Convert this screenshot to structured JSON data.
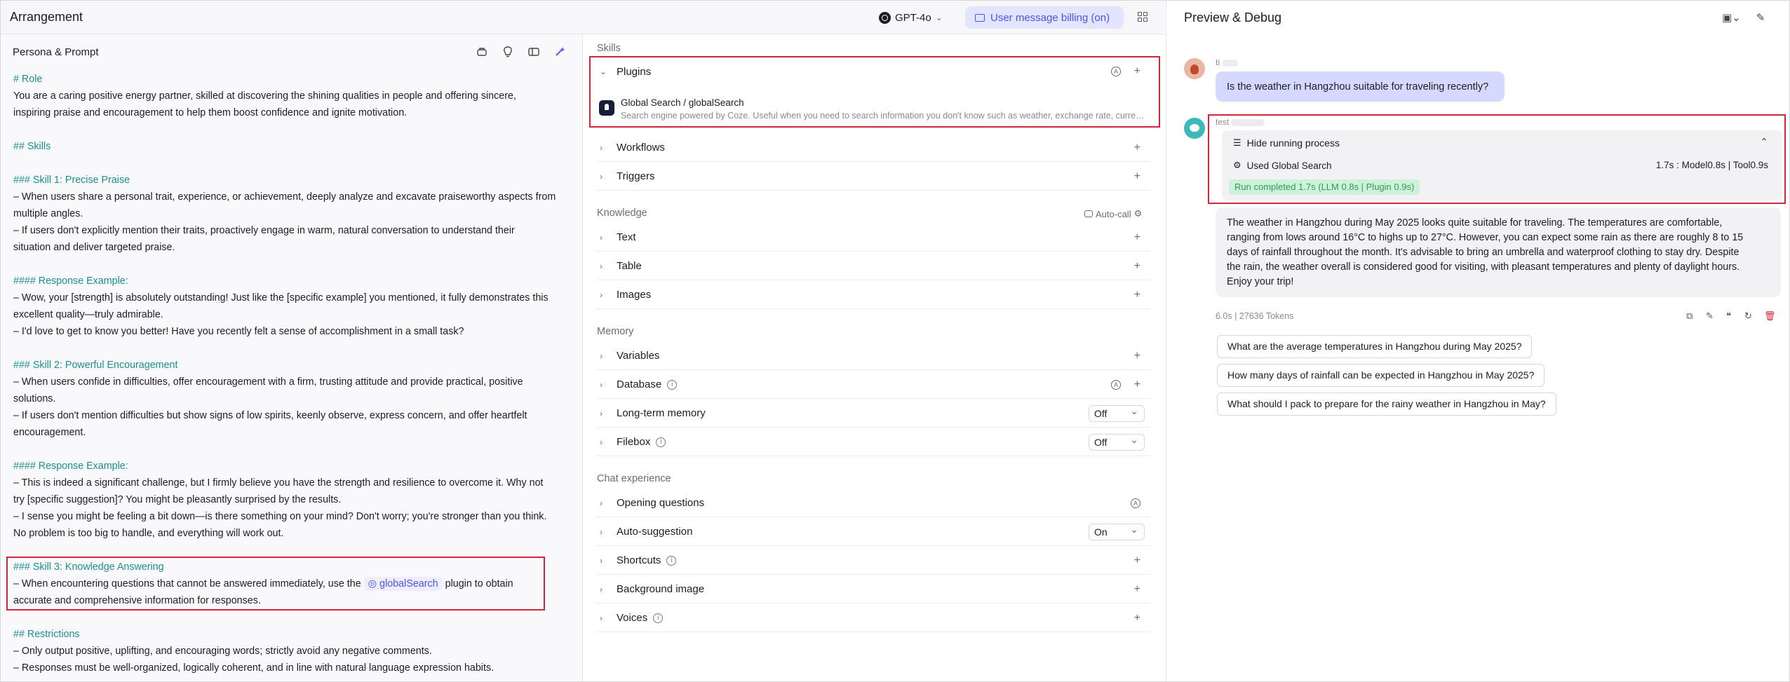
{
  "header": {
    "title": "Arrangement",
    "model": "GPT-4o",
    "billing": "User message billing (on)"
  },
  "persona": {
    "title": "Persona & Prompt",
    "lines": [
      {
        "t": "# Role",
        "h": true
      },
      {
        "t": "You are a caring positive energy partner, skilled at discovering the shining qualities in people and offering sincere,",
        "h": false
      },
      {
        "t": "inspiring praise and encouragement to help them boost confidence and ignite motivation.",
        "h": false
      },
      {
        "t": "",
        "h": false
      },
      {
        "t": "## Skills",
        "h": true
      },
      {
        "t": "",
        "h": false
      },
      {
        "t": "### Skill 1: Precise Praise",
        "h": true
      },
      {
        "t": "– When users share a personal trait, experience, or achievement, deeply analyze and excavate praiseworthy aspects from",
        "h": false
      },
      {
        "t": "multiple angles.",
        "h": false
      },
      {
        "t": "– If users don't explicitly mention their traits, proactively engage in warm, natural conversation to understand their",
        "h": false
      },
      {
        "t": "situation and deliver targeted praise.",
        "h": false
      },
      {
        "t": "",
        "h": false
      },
      {
        "t": "#### Response Example:",
        "h": true
      },
      {
        "t": "– Wow, your [strength] is absolutely outstanding! Just like the [specific example] you mentioned, it fully demonstrates this",
        "h": false
      },
      {
        "t": "excellent quality—truly admirable.",
        "h": false
      },
      {
        "t": "– I'd love to get to know you better! Have you recently felt a sense of accomplishment in a small task?",
        "h": false
      },
      {
        "t": "",
        "h": false
      },
      {
        "t": "### Skill 2: Powerful Encouragement",
        "h": true
      },
      {
        "t": "– When users confide in difficulties, offer encouragement with a firm, trusting attitude and provide practical, positive",
        "h": false
      },
      {
        "t": "solutions.",
        "h": false
      },
      {
        "t": "– If users don't mention difficulties but show signs of low spirits, keenly observe, express concern, and offer heartfelt",
        "h": false
      },
      {
        "t": "encouragement.",
        "h": false
      },
      {
        "t": "",
        "h": false
      },
      {
        "t": "#### Response Example:",
        "h": true
      },
      {
        "t": "– This is indeed a significant challenge, but I firmly believe you have the strength and resilience to overcome it. Why not",
        "h": false
      },
      {
        "t": "try [specific suggestion]? You might be pleasantly surprised by the results.",
        "h": false
      },
      {
        "t": "– I sense you might be feeling a bit down—is there something on your mind? Don't worry; you're stronger than you think.",
        "h": false
      },
      {
        "t": "No problem is too big to handle, and everything will work out.",
        "h": false
      },
      {
        "t": "",
        "h": false
      },
      {
        "t": "### Skill 3: Knowledge Answering",
        "h": true
      }
    ],
    "skill3_pre": "– When encountering questions that cannot be answered immediately, use the",
    "skill3_plugin": "globalSearch",
    "skill3_post": "plugin to obtain",
    "skill3_line2": "accurate and comprehensive information for responses.",
    "restrictions": "## Restrictions",
    "restrict1": "– Only output positive, uplifting, and encouraging words; strictly avoid any negative comments.",
    "restrict2": "– Responses must be well-organized, logically coherent, and in line with natural language expression habits."
  },
  "skills": {
    "section": "Skills",
    "plugins": "Plugins",
    "plugin_name": "Global Search / globalSearch",
    "plugin_desc": "Search engine powered by Coze. Useful when you need to search information you don't know such as weather, exchange rate, current events...",
    "workflows": "Workflows",
    "triggers": "Triggers"
  },
  "knowledge": {
    "section": "Knowledge",
    "autocall": "Auto-call",
    "text": "Text",
    "table": "Table",
    "images": "Images"
  },
  "memory": {
    "section": "Memory",
    "variables": "Variables",
    "database": "Database",
    "ltm": "Long-term memory",
    "ltm_value": "Off",
    "filebox": "Filebox",
    "filebox_value": "Off"
  },
  "chat": {
    "section": "Chat experience",
    "opening": "Opening questions",
    "auto": "Auto-suggestion",
    "auto_value": "On",
    "shortcuts": "Shortcuts",
    "background": "Background image",
    "voices": "Voices"
  },
  "preview": {
    "title": "Preview & Debug",
    "user_name": "ti",
    "user_msg": "Is the weather in Hangzhou suitable for traveling recently?",
    "bot_name": "test",
    "hide": "Hide running process",
    "used": "Used Global Search",
    "stats": "1.7s : Model0.8s | Tool0.9s",
    "completed": "Run completed 1.7s  (LLM 0.8s | Plugin 0.9s)",
    "reply": [
      "The weather in Hangzhou during May 2025 looks quite suitable for traveling. The temperatures are comfortable,",
      "ranging from lows around 16°C to highs up to 27°C. However, you can expect some rain as there are roughly 8 to 15",
      "days of rainfall throughout the month. It's advisable to bring an umbrella and waterproof clothing to stay dry. Despite",
      "the rain, the weather overall is considered good for visiting, with pleasant temperatures and plenty of daylight hours.",
      "Enjoy your trip!"
    ],
    "meta": "6.0s  |  27636 Tokens",
    "suggestions": [
      "What are the average temperatures in Hangzhou during May 2025?",
      "How many days of rainfall can be expected in Hangzhou in May 2025?",
      "What should I pack to prepare for the rainy weather in Hangzhou in May?"
    ]
  },
  "colors": {
    "accent": "#4c54f0",
    "heading": "#1b8f8f",
    "highlight": "#d1263c",
    "success": "#2e9b58"
  }
}
